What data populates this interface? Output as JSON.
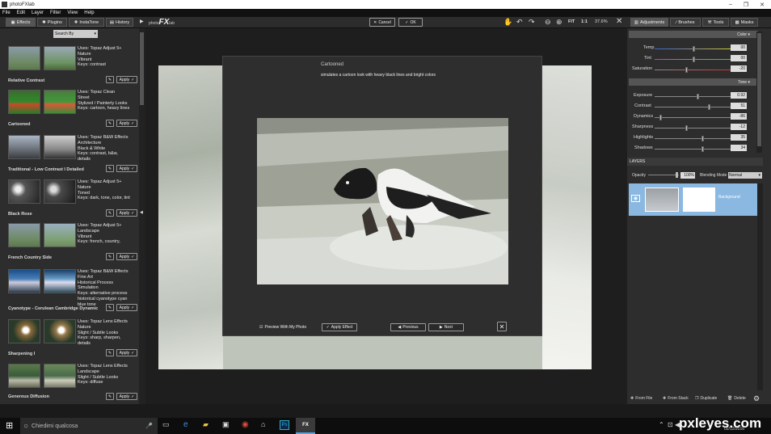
{
  "window": {
    "title": "photoFXlab",
    "controls": [
      "–",
      "❐",
      "✕"
    ]
  },
  "menu": [
    "File",
    "Edit",
    "Layer",
    "Filter",
    "View",
    "Help"
  ],
  "left_tabs": [
    {
      "label": "Effects"
    },
    {
      "label": "Plugins"
    },
    {
      "label": "InstaTone"
    },
    {
      "label": "History"
    }
  ],
  "search": {
    "value": "Search By"
  },
  "effects": [
    {
      "info": [
        "Uses: Topaz Adjust 5+",
        "Nature",
        "Vibrant",
        "Keys: contrast"
      ],
      "name": "Relative Contrast"
    },
    {
      "info": [
        "Uses: Topaz Clean",
        "Street",
        "Stylized / Painterly Looks",
        "Keys: cartoon, heavy lines"
      ],
      "name": "Cartooned"
    },
    {
      "info": [
        "Uses: Topaz B&W Effects",
        "Architecture",
        "Black & White",
        "Keys: contrast, b&w,",
        "details"
      ],
      "name": "Traditional - Low Contrast I Detailed"
    },
    {
      "info": [
        "Uses: Topaz Adjust 5+",
        "Nature",
        "Toned",
        "Keys: dark, tone, color, tint"
      ],
      "name": "Black Rose"
    },
    {
      "info": [
        "Uses: Topaz Adjust 5+",
        "Landscape",
        "Vibrant",
        "Keys: french, country,"
      ],
      "name": "French Country Side"
    },
    {
      "info": [
        "Uses: Topaz B&W Effects",
        "Fine Art",
        "Historical Process",
        "Simulation",
        "Keys: alternative process",
        "historical cyanotype cyan",
        "blue tone"
      ],
      "name": "Cyanotype - Cerulean Cambridge Dynamic"
    },
    {
      "info": [
        "Uses: Topaz Lens Effects",
        "Nature",
        "Slight / Subtle Looks",
        "Keys: sharp, sharpen,",
        "details"
      ],
      "name": "Sharpening I"
    },
    {
      "info": [
        "Uses: Topaz Lens Effects",
        "Landscape",
        "Slight / Subtle Looks",
        "Keys: diffuse"
      ],
      "name": "Generous Diffusion"
    }
  ],
  "apply_label": "Apply",
  "toolbar": {
    "brand_pre": "photo",
    "brand_fx": "FX",
    "brand_post": "lab",
    "cancel": "Cancel",
    "ok": "OK",
    "fit": "FIT",
    "one": "1:1",
    "zoom": "37.6%"
  },
  "right_tabs": [
    {
      "label": "Adjustments"
    },
    {
      "label": "Brushes"
    },
    {
      "label": "Tools"
    },
    {
      "label": "Masks"
    }
  ],
  "color_section": {
    "title": "Color",
    "rows": [
      {
        "label": "Temp",
        "value": "00",
        "pos": 0.5
      },
      {
        "label": "Tint",
        "value": "00",
        "pos": 0.5
      },
      {
        "label": "Saturation",
        "value": "-20",
        "pos": 0.4
      }
    ]
  },
  "tone_section": {
    "title": "Tone",
    "rows": [
      {
        "label": "Exposure",
        "value": "0.92",
        "pos": 0.55
      },
      {
        "label": "Contrast",
        "value": "51",
        "pos": 0.72
      },
      {
        "label": "Dynamics",
        "value": "-86",
        "pos": 0.07
      },
      {
        "label": "Sharpness",
        "value": "-12",
        "pos": 0.42
      },
      {
        "label": "Highlights",
        "value": "35",
        "pos": 0.62
      },
      {
        "label": "Shadows",
        "value": "34",
        "pos": 0.62
      }
    ]
  },
  "layers": {
    "title": "LAYERS",
    "opacity_label": "Opacity",
    "opacity_value": "100%",
    "blend_label": "Blending Mode",
    "blend_value": "Normal",
    "layer_name": "Background"
  },
  "layer_buttons": [
    "From File",
    "From Stack",
    "Duplicate",
    "Delete"
  ],
  "modal": {
    "title": "Cartooned",
    "description": "simulates a cartoon look with heavy black lines and bright colors",
    "preview_label": "Preview With My Photo",
    "apply_effect": "Apply Effect",
    "previous": "Previous",
    "next": "Next"
  },
  "taskbar": {
    "search_placeholder": "Chiedimi qualcosa",
    "date": "02/12/2016",
    "watermark": "pxleyes.com"
  },
  "colors": {
    "accent": "#5aa0d8",
    "selected_layer": "#8ab8e0",
    "dark_panel": "#2d2d2d"
  }
}
